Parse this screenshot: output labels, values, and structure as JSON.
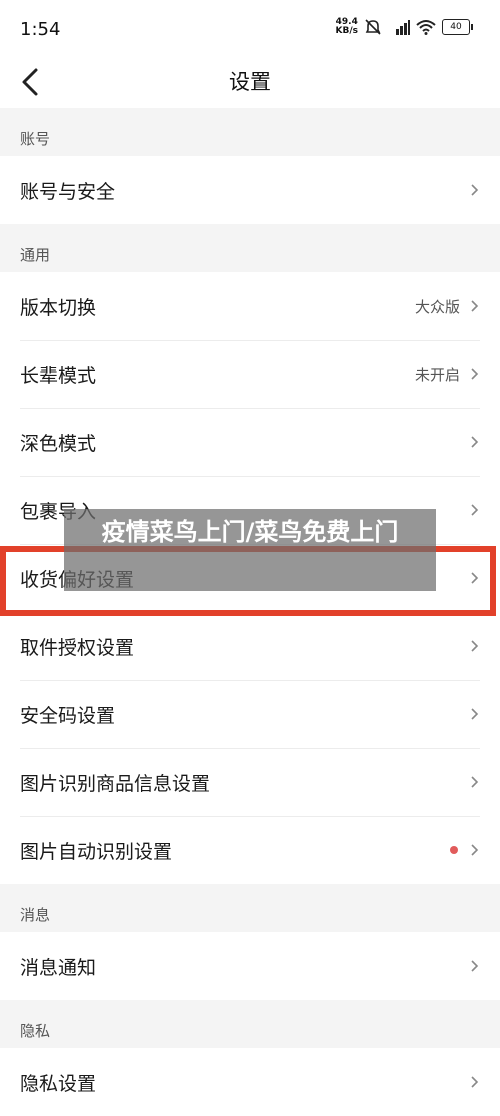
{
  "status_bar": {
    "time": "1:54",
    "network_speed_value": "49.4",
    "network_speed_unit": "KB/s",
    "battery": "40"
  },
  "navbar": {
    "title": "设置"
  },
  "sections": [
    {
      "header": "账号",
      "items": [
        {
          "label": "账号与安全",
          "value": ""
        }
      ]
    },
    {
      "header": "通用",
      "items": [
        {
          "label": "版本切换",
          "value": "大众版"
        },
        {
          "label": "长辈模式",
          "value": "未开启"
        },
        {
          "label": "深色模式",
          "value": ""
        },
        {
          "label": "包裹导入",
          "value": ""
        },
        {
          "label": "收货偏好设置",
          "value": ""
        },
        {
          "label": "取件授权设置",
          "value": ""
        },
        {
          "label": "安全码设置",
          "value": ""
        },
        {
          "label": "图片识别商品信息设置",
          "value": ""
        },
        {
          "label": "图片自动识别设置",
          "value": "",
          "red_dot": true
        }
      ]
    },
    {
      "header": "消息",
      "items": [
        {
          "label": "消息通知",
          "value": ""
        }
      ]
    },
    {
      "header": "隐私",
      "items": [
        {
          "label": "隐私设置",
          "value": ""
        }
      ]
    }
  ],
  "overlay": {
    "watermark_text": "疫情菜鸟上门/菜鸟免费上门"
  },
  "colors": {
    "highlight": "#e2412a",
    "red_dot": "#e15b5b"
  }
}
